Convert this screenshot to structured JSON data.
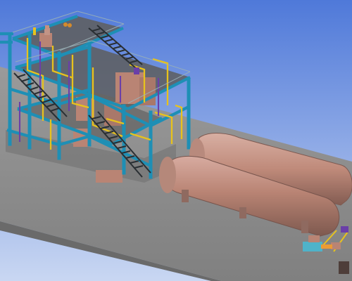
{
  "viewport": {
    "background_top": "#4f79d9",
    "background_bottom": "#c9d7f2",
    "ground_color": "#8e8e8e",
    "ground_edge_color": "#6d6d6d"
  },
  "model": {
    "steel_color": "#1e8fb5",
    "stair_color": "#2a2f33",
    "pipe_yellow": "#e7c21d",
    "pipe_purple": "#6a3fa8",
    "equipment_color": "#b98474",
    "tank_color": "#b98474",
    "accent_orange": "#d48b2c"
  },
  "icons": [
    "industrial-plant-structure",
    "horizontal-storage-tank",
    "horizontal-storage-tank",
    "small-skid-equipment"
  ]
}
